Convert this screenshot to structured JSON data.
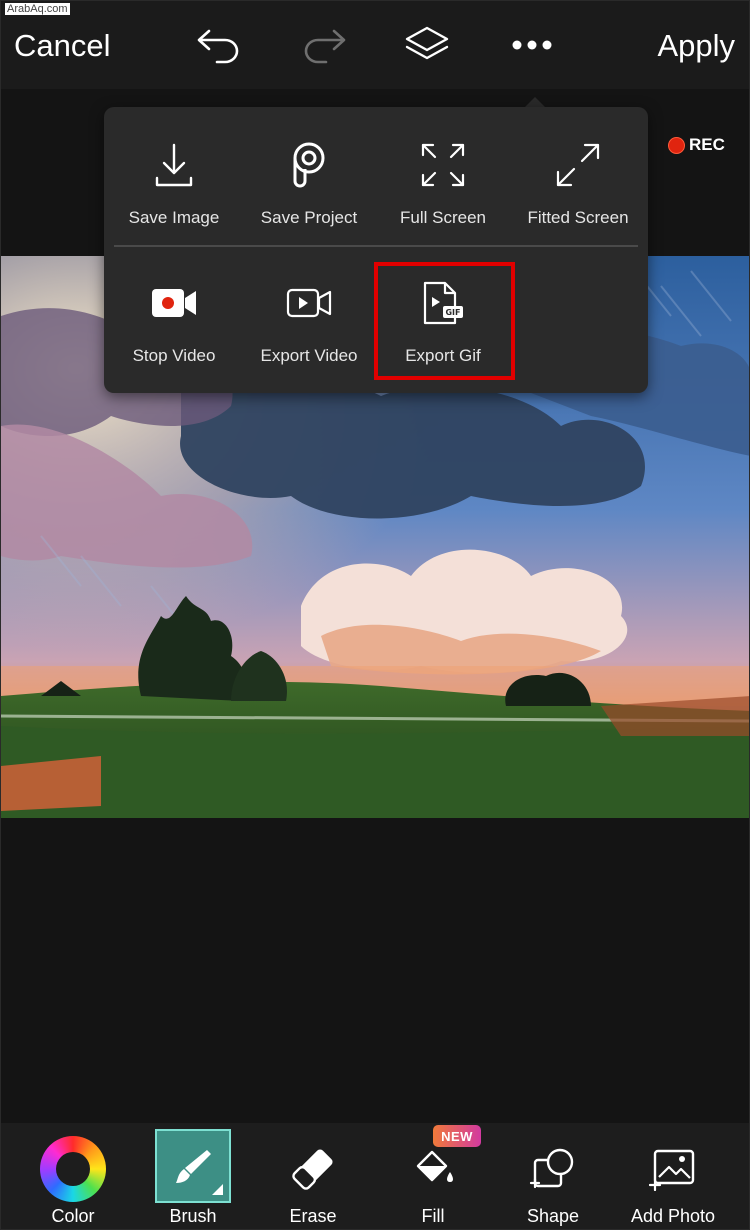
{
  "watermark": "ArabAq.com",
  "topbar": {
    "cancel_label": "Cancel",
    "apply_label": "Apply",
    "icons": [
      "undo-icon",
      "redo-icon",
      "layers-icon",
      "more-icon"
    ]
  },
  "recording": {
    "label": "REC",
    "color": "#e0240f"
  },
  "menu": {
    "items": [
      {
        "label": "Save Image",
        "icon": "download-icon"
      },
      {
        "label": "Save Project",
        "icon": "picsart-logo-icon"
      },
      {
        "label": "Full Screen",
        "icon": "expand-icon"
      },
      {
        "label": "Fitted Screen",
        "icon": "diagonal-expand-icon"
      },
      {
        "label": "Stop Video",
        "icon": "video-record-icon"
      },
      {
        "label": "Export Video",
        "icon": "video-play-icon"
      },
      {
        "label": "Export Gif",
        "icon": "gif-file-icon"
      }
    ],
    "highlighted_item": "Export Gif",
    "highlight_color": "#e10000"
  },
  "toolbar": {
    "tools": [
      {
        "label": "Color",
        "icon": "color-wheel-icon"
      },
      {
        "label": "Brush",
        "icon": "brush-icon",
        "selected": true
      },
      {
        "label": "Erase",
        "icon": "eraser-icon"
      },
      {
        "label": "Fill",
        "icon": "fill-bucket-icon",
        "badge": "NEW"
      },
      {
        "label": "Shape",
        "icon": "shape-icon"
      },
      {
        "label": "Add Photo",
        "icon": "add-photo-icon"
      }
    ],
    "selected_color": "#3d8f85"
  }
}
